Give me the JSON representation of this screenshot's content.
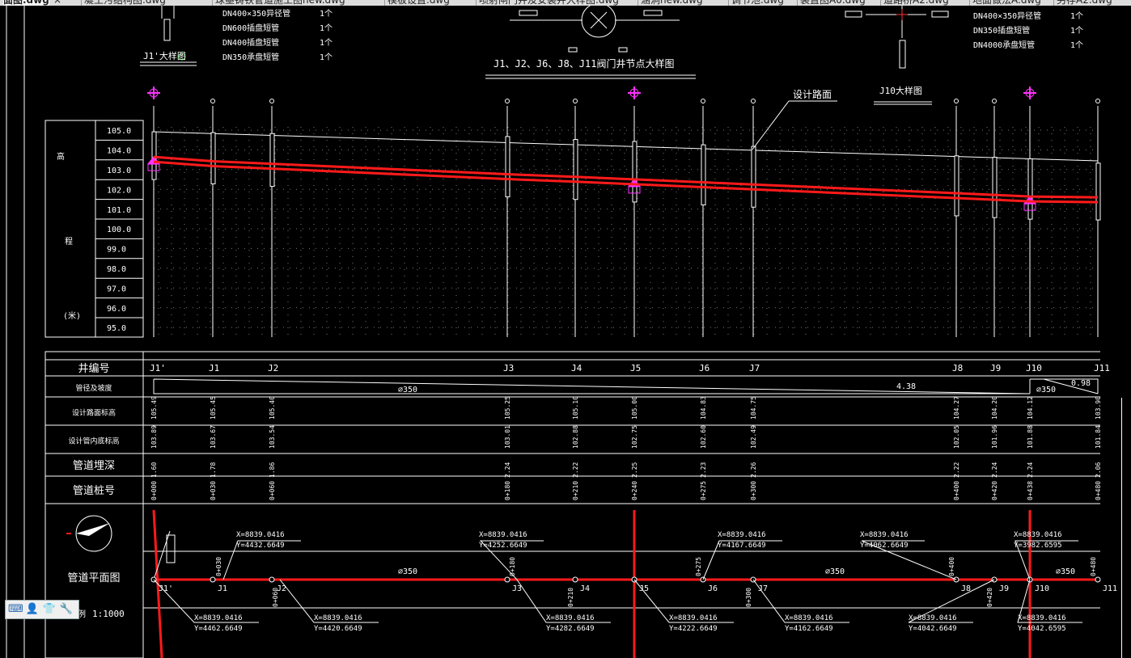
{
  "tabs": [
    {
      "label": "面图.dwg",
      "active": true
    },
    {
      "label": "凝土污结构图.dwg"
    },
    {
      "label": "球墨铸铁管道施工图new.dwg"
    },
    {
      "label": "模板设置.dwg"
    },
    {
      "label": "喷射闸门井及安装井大样图.dwg"
    },
    {
      "label": "涵洞new.dwg"
    },
    {
      "label": "调节池.dwg"
    },
    {
      "label": "装置图A0.dwg"
    },
    {
      "label": "道路桥A2.dwg"
    },
    {
      "label": "地面做法A.dwg"
    },
    {
      "label": "另存A2.dwg"
    }
  ],
  "close_glyph": "×",
  "pipe_list_left": [
    {
      "name": "DN400×350异径管",
      "qty": "1个"
    },
    {
      "name": "DN600插盘短管",
      "qty": "1个"
    },
    {
      "name": "DN400插盘短管",
      "qty": "1个"
    },
    {
      "name": "DN350承盘短管",
      "qty": "1个"
    }
  ],
  "pipe_list_right": [
    {
      "name": "DN400×350异径管",
      "qty": "1个"
    },
    {
      "name": "DN350插盘短管",
      "qty": "1个"
    },
    {
      "name": "DN4000承盘短管",
      "qty": "1个"
    }
  ],
  "detail_j1": "J1'大样图",
  "detail_valve": "J1、J2、J6、J8、J11阀门井节点大样图",
  "detail_j10": "J10大样图",
  "road_label": "设计路面",
  "elev_label_a": "高",
  "elev_label_b": "程",
  "elev_label_c": "(米)",
  "elevations": [
    "105.0",
    "104.0",
    "103.0",
    "102.0",
    "101.0",
    "100.0",
    "99.0",
    "98.0",
    "97.0",
    "96.0",
    "95.0"
  ],
  "row_labels": {
    "well": "井编号",
    "slope": "管径及坡度",
    "road": "设计路面标高",
    "invert": "设计管内底标高",
    "depth": "管道埋深",
    "station": "管道桩号",
    "plan": "管道平面图",
    "scale_prefix": "例",
    "scale": "1:1000"
  },
  "pipe_dia": "⌀350",
  "slope_main": "4.38",
  "slope_end": "0.98",
  "wells": [
    {
      "id": "J1'",
      "road": "105.49",
      "invert": "103.89",
      "depth": "1.60",
      "station": "0+000"
    },
    {
      "id": "J1",
      "road": "105.45",
      "invert": "103.67",
      "depth": "1.78",
      "station": "0+030"
    },
    {
      "id": "J2",
      "road": "105.40",
      "invert": "103.54",
      "depth": "1.86",
      "station": "0+060"
    },
    {
      "id": "J3",
      "road": "105.25",
      "invert": "103.01",
      "depth": "2.24",
      "station": "0+180"
    },
    {
      "id": "J4",
      "road": "105.10",
      "invert": "102.88",
      "depth": "2.22",
      "station": "0+210"
    },
    {
      "id": "J5",
      "road": "105.00",
      "invert": "102.75",
      "depth": "2.25",
      "station": "0+240"
    },
    {
      "id": "J6",
      "road": "104.83",
      "invert": "102.60",
      "depth": "2.23",
      "station": "0+275"
    },
    {
      "id": "J7",
      "road": "104.75",
      "invert": "102.49",
      "depth": "2.26",
      "station": "0+300"
    },
    {
      "id": "J8",
      "road": "104.27",
      "invert": "102.05",
      "depth": "2.22",
      "station": "0+400"
    },
    {
      "id": "J9",
      "road": "104.20",
      "invert": "101.96",
      "depth": "2.24",
      "station": "0+420"
    },
    {
      "id": "J10",
      "road": "104.12",
      "invert": "101.88",
      "depth": "2.24",
      "station": "0+438"
    },
    {
      "id": "J11",
      "road": "103.90",
      "invert": "101.84",
      "depth": "2.06",
      "station": "0+480"
    }
  ],
  "coords_top": [
    {
      "x": "X=8839.0416",
      "y": "Y=4432.6649"
    },
    {
      "x": "X=8839.0416",
      "y": "Y=4252.6649"
    },
    {
      "x": "X=8839.0416",
      "y": "Y=4167.6649"
    },
    {
      "x": "X=8839.0416",
      "y": "Y=4062.6649"
    },
    {
      "x": "X=8839.0416",
      "y": "Y=3982.6595"
    }
  ],
  "coords_bottom": [
    {
      "x": "X=8839.0416",
      "y": "Y=4462.6649"
    },
    {
      "x": "X=8839.0416",
      "y": "Y=4420.6649"
    },
    {
      "x": "X=8839.0416",
      "y": "Y=4282.6649"
    },
    {
      "x": "X=8839.0416",
      "y": "Y=4222.6649"
    },
    {
      "x": "X=8839.0416",
      "y": "Y=4162.6649"
    },
    {
      "x": "X=8839.0416",
      "y": "Y=4042.6649"
    },
    {
      "x": "X=8839.0416",
      "y": "Y=4042.6595"
    }
  ],
  "plan_stations": [
    "0+030",
    "0+060",
    "0+180",
    "0+210",
    "0+275",
    "0+300",
    "0+400",
    "0+420",
    "0+480"
  ],
  "colors": {
    "pipe": "#ff1a1a",
    "fitting": "#ff33ff",
    "line": "#ffffff",
    "grid": "#7a7a7a"
  },
  "icons": {
    "keyboard": "keyboard-icon",
    "user": "user-icon",
    "shirt": "shirt-icon",
    "wrench": "wrench-icon"
  }
}
